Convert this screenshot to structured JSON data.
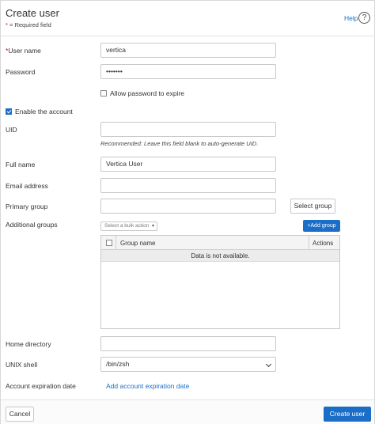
{
  "header": {
    "title": "Create user",
    "required_star": "*",
    "required_note": " = Required field",
    "help_label": "Help",
    "help_icon_glyph": "?"
  },
  "form": {
    "user_name": {
      "star": "*",
      "label": "User name",
      "value": "vertica"
    },
    "password": {
      "label": "Password",
      "value": "•••••••"
    },
    "allow_expire": {
      "label": "Allow password to expire",
      "checked": false
    },
    "enable_account": {
      "label": "Enable the account",
      "checked": true
    },
    "uid": {
      "label": "UID",
      "value": "",
      "hint": "Recommended: Leave this field blank to auto-generate UID."
    },
    "full_name": {
      "label": "Full name",
      "value": "Vertica User"
    },
    "email": {
      "label": "Email address",
      "value": ""
    },
    "primary_group": {
      "label": "Primary group",
      "value": "",
      "button": "Select group"
    },
    "additional_groups": {
      "label": "Additional groups",
      "bulk_action": "Select a bulk action",
      "add_button": "+Add group",
      "columns": [
        "Group name",
        "Actions"
      ],
      "empty_text": "Data is not available."
    },
    "home_directory": {
      "label": "Home directory",
      "value": ""
    },
    "unix_shell": {
      "label": "UNIX shell",
      "value": "/bin/zsh"
    },
    "account_expiration": {
      "label": "Account expiration date",
      "link": "Add account expiration date"
    }
  },
  "footer": {
    "cancel_label": "Cancel",
    "create_label": "Create user"
  },
  "colors": {
    "accent": "#1a6ec7",
    "required": "#d0021b"
  }
}
